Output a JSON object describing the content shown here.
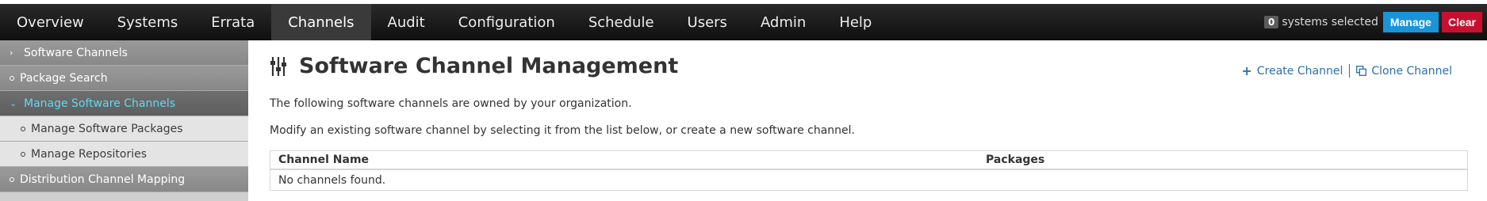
{
  "nav": {
    "items": [
      {
        "label": "Overview"
      },
      {
        "label": "Systems"
      },
      {
        "label": "Errata"
      },
      {
        "label": "Channels"
      },
      {
        "label": "Audit"
      },
      {
        "label": "Configuration"
      },
      {
        "label": "Schedule"
      },
      {
        "label": "Users"
      },
      {
        "label": "Admin"
      },
      {
        "label": "Help"
      }
    ],
    "active": "Channels"
  },
  "ssm": {
    "count": "0",
    "text": "systems selected",
    "manage_label": "Manage",
    "clear_label": "Clear"
  },
  "sidebar": {
    "items": [
      {
        "label": "Software Channels",
        "icon": "chevron-right-icon"
      },
      {
        "label": "Package Search",
        "icon": "bullet-icon"
      },
      {
        "label": "Manage Software Channels",
        "icon": "chevron-down-icon"
      },
      {
        "label": "Manage Software Packages",
        "icon": "bullet-icon"
      },
      {
        "label": "Manage Repositories",
        "icon": "bullet-icon"
      },
      {
        "label": "Distribution Channel Mapping",
        "icon": "bullet-icon"
      }
    ]
  },
  "main": {
    "title": "Software Channel Management",
    "title_icon": "sliders-icon",
    "create_label": "Create Channel",
    "clone_label": "Clone Channel",
    "intro": "The following software channels are owned by your organization.",
    "instructions": "Modify an existing software channel by selecting it from the list below, or create a new software channel.",
    "table": {
      "columns": [
        "Channel Name",
        "Packages"
      ],
      "empty_message": "No channels found."
    }
  },
  "colors": {
    "nav_bg": "#141414",
    "manage_btn": "#1a94d8",
    "clear_btn": "#c8102e",
    "sidebar_active_text": "#5fd8f0",
    "link": "#2d6fa8"
  }
}
